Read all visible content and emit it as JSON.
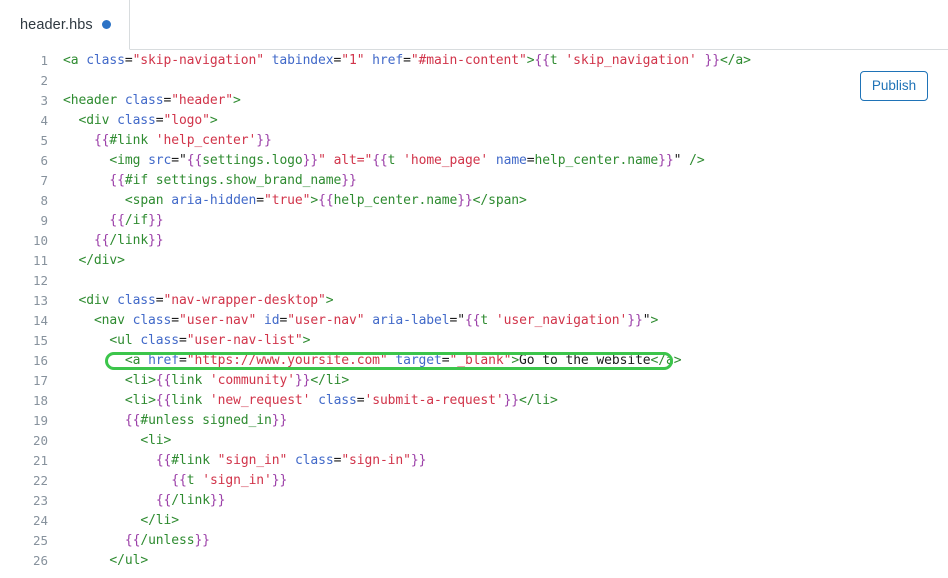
{
  "window": {
    "title": "header.hbs"
  },
  "tab_bar": {
    "tabs": [
      {
        "label": "header.hbs",
        "modified_indicator": "unsaved-dot",
        "dot_color": "#2c73c6"
      }
    ]
  },
  "toolbar": {
    "publish_label": "Publish",
    "publish_color": "#1f73b7"
  },
  "editor": {
    "language": "handlebars",
    "highlight_color": "#3cc54b",
    "highlighted_line": 16,
    "colors": {
      "tag": "#2e8b30",
      "attribute": "#4169c9",
      "string": "#d1344a",
      "handlebars_brace": "#9b3fa8",
      "text": "#1a1a1a",
      "line_number": "#87929d"
    },
    "lines": [
      {
        "n": 1,
        "text": "<a class=\"skip-navigation\" tabindex=\"1\" href=\"#main-content\">{{t 'skip_navigation' }}</a>"
      },
      {
        "n": 2,
        "text": ""
      },
      {
        "n": 3,
        "text": "<header class=\"header\">"
      },
      {
        "n": 4,
        "text": "  <div class=\"logo\">"
      },
      {
        "n": 5,
        "text": "    {{#link 'help_center'}}"
      },
      {
        "n": 6,
        "text": "      <img src=\"{{settings.logo}}\" alt=\"{{t 'home_page' name=help_center.name}}\" />"
      },
      {
        "n": 7,
        "text": "      {{#if settings.show_brand_name}}"
      },
      {
        "n": 8,
        "text": "        <span aria-hidden=\"true\">{{help_center.name}}</span>"
      },
      {
        "n": 9,
        "text": "      {{/if}}"
      },
      {
        "n": 10,
        "text": "    {{/link}}"
      },
      {
        "n": 11,
        "text": "  </div>"
      },
      {
        "n": 12,
        "text": ""
      },
      {
        "n": 13,
        "text": "  <div class=\"nav-wrapper-desktop\">"
      },
      {
        "n": 14,
        "text": "    <nav class=\"user-nav\" id=\"user-nav\" aria-label=\"{{t 'user_navigation'}}\">"
      },
      {
        "n": 15,
        "text": "      <ul class=\"user-nav-list\">"
      },
      {
        "n": 16,
        "text": "        <a href=\"https://www.yoursite.com\" target=\"_blank\">Go to the website</a>"
      },
      {
        "n": 17,
        "text": "        <li>{{link 'community'}}</li>"
      },
      {
        "n": 18,
        "text": "        <li>{{link 'new_request' class='submit-a-request'}}</li>"
      },
      {
        "n": 19,
        "text": "        {{#unless signed_in}}"
      },
      {
        "n": 20,
        "text": "          <li>"
      },
      {
        "n": 21,
        "text": "            {{#link \"sign_in\" class=\"sign-in\"}}"
      },
      {
        "n": 22,
        "text": "              {{t 'sign_in'}}"
      },
      {
        "n": 23,
        "text": "            {{/link}}"
      },
      {
        "n": 24,
        "text": "          </li>"
      },
      {
        "n": 25,
        "text": "        {{/unless}}"
      },
      {
        "n": 26,
        "text": "      </ul>"
      }
    ]
  }
}
